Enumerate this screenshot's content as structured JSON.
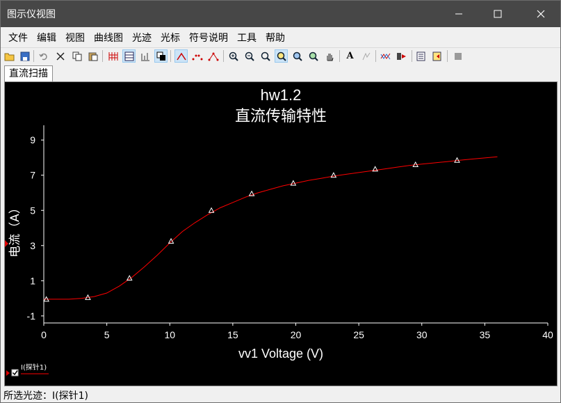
{
  "window": {
    "title": "图示仪视图"
  },
  "menu": [
    "文件",
    "编辑",
    "视图",
    "曲线图",
    "光迹",
    "光标",
    "符号说明",
    "工具",
    "帮助"
  ],
  "tabs": [
    {
      "label": "直流扫描"
    }
  ],
  "status": {
    "text": "所选光迹：I(探针1)"
  },
  "legend": {
    "label": "I(探针1)"
  },
  "chart_data": {
    "type": "line",
    "title": "hw1.2",
    "subtitle": "直流传输特性",
    "xlabel": "vv1 Voltage (V)",
    "ylabel": "电流（A）",
    "xlim": [
      0,
      40
    ],
    "ylim": [
      -1.4,
      9.6
    ],
    "xticks": [
      0,
      5,
      10,
      15,
      20,
      25,
      30,
      35,
      40
    ],
    "yticks": [
      -1,
      1,
      3,
      5,
      7,
      9
    ],
    "grid": false,
    "line_color": "#ff0000",
    "marker": "triangle",
    "series": [
      {
        "name": "I(探针1)",
        "curve": [
          [
            0,
            -0.05
          ],
          [
            1,
            -0.05
          ],
          [
            2,
            -0.05
          ],
          [
            3,
            0.0
          ],
          [
            4,
            0.1
          ],
          [
            5,
            0.3
          ],
          [
            6,
            0.7
          ],
          [
            7,
            1.2
          ],
          [
            8,
            1.8
          ],
          [
            9,
            2.45
          ],
          [
            10,
            3.15
          ],
          [
            11,
            3.8
          ],
          [
            12,
            4.3
          ],
          [
            13,
            4.75
          ],
          [
            14,
            5.15
          ],
          [
            15,
            5.45
          ],
          [
            16,
            5.75
          ],
          [
            17,
            6.0
          ],
          [
            18,
            6.2
          ],
          [
            19,
            6.4
          ],
          [
            20,
            6.55
          ],
          [
            21,
            6.7
          ],
          [
            22,
            6.82
          ],
          [
            23,
            6.95
          ],
          [
            24,
            7.05
          ],
          [
            25,
            7.15
          ],
          [
            26,
            7.25
          ],
          [
            27,
            7.35
          ],
          [
            28,
            7.45
          ],
          [
            29,
            7.55
          ],
          [
            30,
            7.63
          ],
          [
            31,
            7.7
          ],
          [
            32,
            7.77
          ],
          [
            33,
            7.85
          ],
          [
            34,
            7.92
          ],
          [
            35,
            7.98
          ],
          [
            36,
            8.05
          ]
        ],
        "markers": [
          [
            0.2,
            -0.05
          ],
          [
            3.5,
            0.05
          ],
          [
            6.8,
            1.15
          ],
          [
            10.1,
            3.25
          ],
          [
            13.3,
            5.0
          ],
          [
            16.5,
            5.95
          ],
          [
            19.8,
            6.55
          ],
          [
            23.0,
            7.0
          ],
          [
            26.3,
            7.35
          ],
          [
            29.5,
            7.6
          ],
          [
            32.8,
            7.85
          ]
        ]
      }
    ]
  }
}
